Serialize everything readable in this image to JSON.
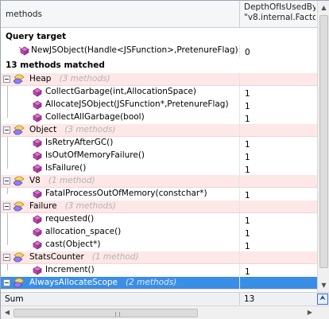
{
  "header": {
    "col_methods": "methods",
    "col_metric_line1": "DepthOfIsUsedBy",
    "col_metric_line2": "\"v8.internal.Factor"
  },
  "query_target": {
    "title": "Query target",
    "method": "NewJSObject(Handle<JSFunction>,PretenureFlag)",
    "value": "0"
  },
  "matched": {
    "title": "13 methods matched"
  },
  "groups": [
    {
      "name": "Heap",
      "count": "(3 methods)",
      "methods": [
        {
          "name": "CollectGarbage(int,AllocationSpace)",
          "value": "1"
        },
        {
          "name": "AllocateJSObject(JSFunction*,PretenureFlag)",
          "value": "1"
        },
        {
          "name": "CollectAllGarbage(bool)",
          "value": "1"
        }
      ]
    },
    {
      "name": "Object",
      "count": "(3 methods)",
      "methods": [
        {
          "name": "IsRetryAfterGC()",
          "value": "1"
        },
        {
          "name": "IsOutOfMemoryFailure()",
          "value": "1"
        },
        {
          "name": "IsFailure()",
          "value": "1"
        }
      ]
    },
    {
      "name": "V8",
      "count": "(1 method)",
      "methods": [
        {
          "name": "FatalProcessOutOfMemory(constchar*)",
          "value": "1"
        }
      ]
    },
    {
      "name": "Failure",
      "count": "(3 methods)",
      "methods": [
        {
          "name": "requested()",
          "value": "1"
        },
        {
          "name": "allocation_space()",
          "value": "1"
        },
        {
          "name": "cast(Object*)",
          "value": "1"
        }
      ]
    },
    {
      "name": "StatsCounter",
      "count": "(1 method)",
      "methods": [
        {
          "name": "Increment()",
          "value": "1"
        }
      ]
    },
    {
      "name": "AlwaysAllocateScope",
      "count": "(2 methods)",
      "methods": []
    }
  ],
  "sum": {
    "label": "Sum",
    "value": "13",
    "button": "⮝"
  },
  "scroll": {
    "up": "▲",
    "down": "▼",
    "left": "◀",
    "right": "▶"
  },
  "colors": {
    "group_row": "#fde7e7",
    "selected_row": "#3a8ee6",
    "method_icon": "#c44bb5",
    "type_icon": "#7a6ad6"
  }
}
